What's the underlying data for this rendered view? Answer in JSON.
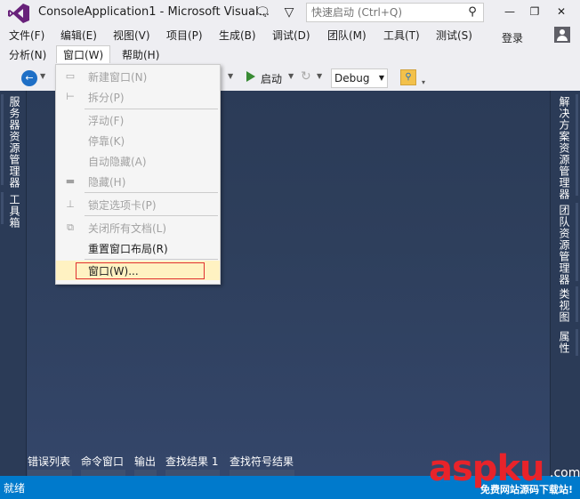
{
  "window": {
    "title": "ConsoleApplication1 - Microsoft Visual...",
    "quick_launch_placeholder": "快速启动 (Ctrl+Q)",
    "controls": {
      "minimize": "—",
      "restore": "❐",
      "close": "✕"
    }
  },
  "menubar": {
    "row1": [
      "文件(F)",
      "编辑(E)",
      "视图(V)",
      "项目(P)",
      "生成(B)",
      "调试(D)",
      "团队(M)",
      "工具(T)",
      "测试(S)"
    ],
    "row2": [
      "分析(N)",
      "窗口(W)",
      "帮助(H)"
    ],
    "login": "登录"
  },
  "toolbar": {
    "start_label": "启动",
    "configuration": "Debug"
  },
  "window_menu": {
    "items": [
      {
        "label": "新建窗口(N)",
        "icon": "new-window-icon",
        "enabled": false
      },
      {
        "label": "拆分(P)",
        "icon": "split-icon",
        "enabled": false
      },
      {
        "label": "浮动(F)",
        "icon": "",
        "enabled": false
      },
      {
        "label": "停靠(K)",
        "icon": "",
        "enabled": false
      },
      {
        "label": "自动隐藏(A)",
        "icon": "",
        "enabled": false
      },
      {
        "label": "隐藏(H)",
        "icon": "hide-icon",
        "enabled": false
      },
      {
        "label": "锁定选项卡(P)",
        "icon": "pin-icon",
        "enabled": false
      },
      {
        "label": "关闭所有文档(L)",
        "icon": "close-all-icon",
        "enabled": false
      },
      {
        "label": "重置窗口布局(R)",
        "icon": "",
        "enabled": true
      },
      {
        "label": "窗口(W)...",
        "icon": "",
        "enabled": true,
        "highlighted": true
      }
    ]
  },
  "left_panels": [
    "服务器资源管理器",
    "工具箱"
  ],
  "right_panels": [
    "解决方案资源管理器",
    "团队资源管理器",
    "类视图",
    "属性"
  ],
  "bottom_tabs": [
    "错误列表",
    "命令窗口",
    "输出",
    "查找结果 1",
    "查找符号结果"
  ],
  "status": {
    "text": "就绪"
  },
  "watermark": {
    "brand_left": "asp",
    "brand_right": "ku",
    "tld": ".com",
    "slogan": "免费网站源码下载站!"
  },
  "colors": {
    "accent": "#007acc",
    "editor_bg": "#2e3f5c",
    "highlight": "#fff2c2",
    "red_box": "#e03030"
  }
}
